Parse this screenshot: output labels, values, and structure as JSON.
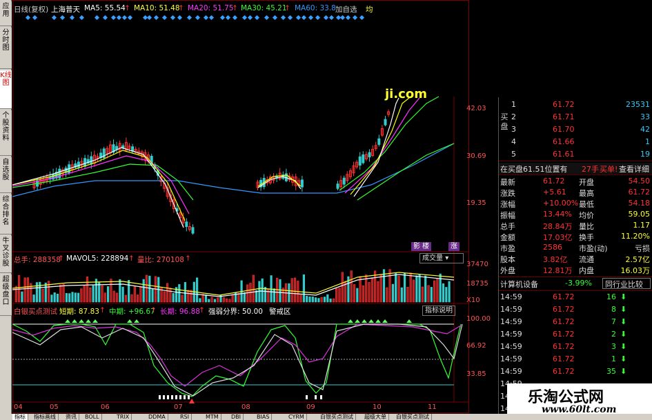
{
  "nav_items": [
    {
      "label": "应用",
      "active": false
    },
    {
      "label": "分时图",
      "active": false
    },
    {
      "label": "K线图",
      "active": true
    },
    {
      "label": "个股资料",
      "active": false
    },
    {
      "label": "自选股",
      "active": false
    },
    {
      "label": "综合排名",
      "active": false
    },
    {
      "label": "牛叉诊股",
      "active": false
    },
    {
      "label": "超级盘口",
      "active": false
    }
  ],
  "header": {
    "mode": "日线(复权)",
    "stock_name": "上海普天",
    "ma5": "MA5: 55.54",
    "ma10": "MA10: 51.48",
    "ma20": "MA20: 51.75",
    "ma30": "MA30: 45.21",
    "ma60": "MA60: 33.8",
    "add_watch": "加自选",
    "trailing": "均",
    "arrow": "↑"
  },
  "price_axis": [
    "42.03",
    "30.69",
    "19.35"
  ],
  "overlay_text": "ji.com",
  "volume": {
    "total": "总手: 288358",
    "mavol": "MAVOL5: 228894",
    "ratio": "量比: 270108",
    "arrow": "↑",
    "dropdown": "成交量",
    "axis": [
      "37470",
      "18735",
      "X10"
    ],
    "badges": [
      "影",
      "楼",
      "涨"
    ]
  },
  "indicator": {
    "name": "白银买点测试",
    "short": "短期: 87.83",
    "mid": "中期: +96.67",
    "long": "长期: 96.88",
    "strength": "强弱分界: 50.00",
    "alert": "警戒区",
    "arrow": "↑",
    "help_button": "指标说明",
    "axis": [
      "100.00",
      "66.92",
      "33.85"
    ]
  },
  "date_axis": [
    "04",
    "05",
    "06",
    "07",
    "08",
    "09",
    "10",
    "11"
  ],
  "panel": {
    "buy_label": "买盘",
    "bids": [
      {
        "n": "1",
        "price": "61.72",
        "vol": "23531"
      },
      {
        "n": "2",
        "price": "61.71",
        "vol": "33"
      },
      {
        "n": "3",
        "price": "61.70",
        "vol": "42"
      },
      {
        "n": "4",
        "price": "61.66",
        "vol": "1"
      },
      {
        "n": "5",
        "price": "61.61",
        "vol": "19"
      }
    ],
    "bid_line": "在买盘61.51位置有",
    "bid_line_qty": "27手",
    "bid_line_action": "买单!",
    "bid_line_link": "查看详细",
    "stats": [
      {
        "l1": "最新",
        "v1": "61.72",
        "l2": "开盘",
        "v2": "54.50"
      },
      {
        "l1": "涨跌",
        "v1": "+5.61",
        "l2": "最高",
        "v2": "61.72"
      },
      {
        "l1": "涨幅",
        "v1": "+10.00%",
        "l2": "最低",
        "v2": "54.18"
      },
      {
        "l1": "振幅",
        "v1": "13.44%",
        "l2": "均价",
        "v2": "59.05"
      },
      {
        "l1": "总手",
        "v1": "28.84万",
        "l2": "量比",
        "v2": "1.17"
      },
      {
        "l1": "金额",
        "v1": "17.03亿",
        "l2": "换手",
        "v2": "11.20%"
      },
      {
        "l1": "市盈",
        "v1": "2586",
        "l2": "市盈(动)",
        "v2": "亏损"
      },
      {
        "l1": "股本",
        "v1": "3.82亿",
        "l2": "流通",
        "v2": "2.57亿"
      },
      {
        "l1": "外盘",
        "v1": "12.81万",
        "l2": "内盘",
        "v2": "16.03万"
      }
    ],
    "sector_name": "计算机设备",
    "sector_change": "-3.99%",
    "sector_button": "同行业比较",
    "trades": [
      {
        "t": "14:59",
        "p": "61.72",
        "v": "16"
      },
      {
        "t": "14:59",
        "p": "61.72",
        "v": "8"
      },
      {
        "t": "14:59",
        "p": "61.72",
        "v": "7"
      },
      {
        "t": "14:59",
        "p": "61.72",
        "v": "2"
      },
      {
        "t": "14:59",
        "p": "61.72",
        "v": "3"
      },
      {
        "t": "14:59",
        "p": "61.72",
        "v": "1"
      },
      {
        "t": "14:59",
        "p": "61.72",
        "v": "35"
      },
      {
        "t": "14:59",
        "p": "",
        "v": ""
      },
      {
        "t": "14:59",
        "p": "",
        "v": ""
      },
      {
        "t": "14:59",
        "p": "",
        "v": ""
      }
    ]
  },
  "watermark": {
    "title": "乐淘公式网",
    "url": "www.60lt.com"
  },
  "bottom_tabs": [
    "指标",
    "指标画线",
    "资讯",
    "BOLL",
    "TRIX",
    "DDMA",
    "RSI",
    "MTM",
    "DBI",
    "BIAS",
    "CYRM",
    "白银买点测试",
    "超级大单",
    "白银买点测试"
  ],
  "colors": {
    "up": "#ff3333",
    "down": "#33cccc",
    "ma5": "#ffffff",
    "ma10": "#ffff00",
    "ma20": "#ff33ff",
    "ma30": "#33ff33",
    "ma60": "#3399ff"
  }
}
